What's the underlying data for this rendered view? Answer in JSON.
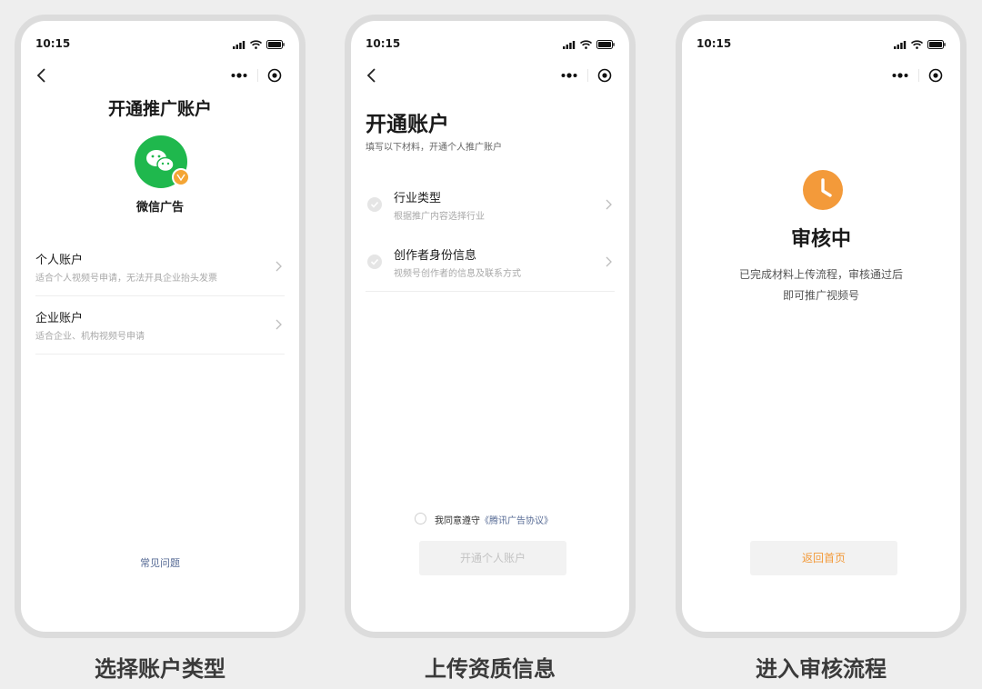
{
  "status_bar": {
    "time": "10:15"
  },
  "screen1": {
    "title": "开通推广账户",
    "brand": "微信广告",
    "options": [
      {
        "title": "个人账户",
        "desc": "适合个人视频号申请，无法开具企业抬头发票"
      },
      {
        "title": "企业账户",
        "desc": "适合企业、机构视频号申请"
      }
    ],
    "faq": "常见问题"
  },
  "screen2": {
    "title": "开通账户",
    "subtitle": "填写以下材料，开通个人推广账户",
    "steps": [
      {
        "title": "行业类型",
        "desc": "根据推广内容选择行业"
      },
      {
        "title": "创作者身份信息",
        "desc": "视频号创作者的信息及联系方式"
      }
    ],
    "agree_prefix": "我同意遵守",
    "agree_link": "《腾讯广告协议》",
    "submit": "开通个人账户"
  },
  "screen3": {
    "title": "审核中",
    "desc_line1": "已完成材料上传流程，审核通过后",
    "desc_line2": "即可推广视频号",
    "home_button": "返回首页"
  },
  "captions": [
    "选择账户类型",
    "上传资质信息",
    "进入审核流程"
  ],
  "colors": {
    "wechat_green": "#1fb84d",
    "accent_orange": "#f39a3a",
    "link_blue": "#576b95"
  },
  "icons": [
    "back-chevron-icon",
    "more-dots-icon",
    "close-target-icon",
    "wechat-logo-icon",
    "clock-icon",
    "check-circle-icon",
    "chevron-right-icon",
    "signal-icon",
    "wifi-icon",
    "battery-icon"
  ]
}
